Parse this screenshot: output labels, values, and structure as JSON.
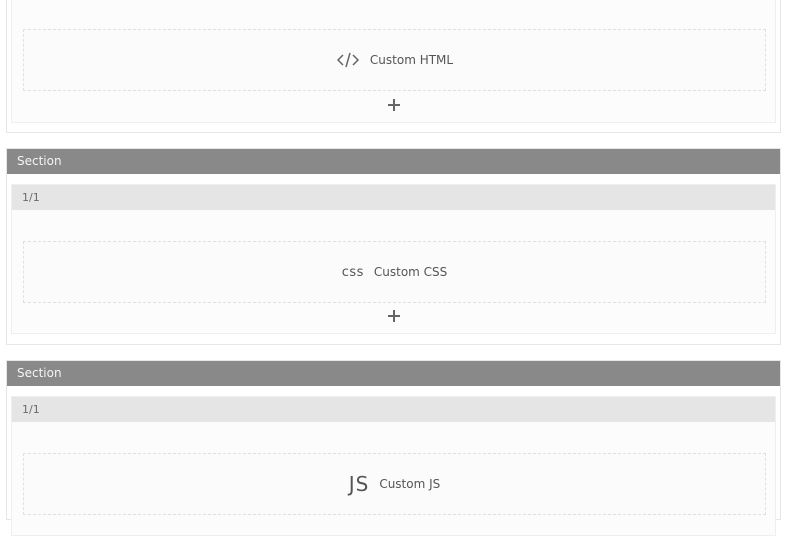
{
  "sections": [
    {
      "header": "",
      "column": "",
      "element": {
        "icon": "code-icon",
        "label": "Custom HTML"
      }
    },
    {
      "header": "Section",
      "column": "1/1",
      "element": {
        "icon_text": "css",
        "label": "Custom CSS"
      }
    },
    {
      "header": "Section",
      "column": "1/1",
      "element": {
        "icon_text": "JS",
        "label": "Custom JS"
      }
    }
  ]
}
